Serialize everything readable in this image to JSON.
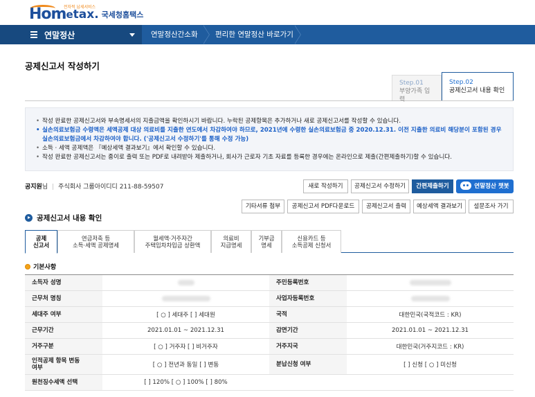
{
  "header": {
    "logo_main": "Hom",
    "logo_e": "e",
    "logo_tax": "tax.",
    "logo_tagline": "전자적 납세서비스",
    "logo_korean": "국세청홈택스"
  },
  "nav": {
    "main_label": "연말정산",
    "items": [
      "연말정산간소화",
      "편리한 연말정산 바로가기"
    ]
  },
  "page": {
    "title": "공제신고서 작성하기",
    "steps": [
      {
        "no": "Step.01",
        "label": "부양가족 입력"
      },
      {
        "no": "Step.02",
        "label": "공제신고서 내용 확인"
      }
    ]
  },
  "info": {
    "lines": [
      "작성 완료한 공제신고서와 부속명세서의 지출금액을 확인하시기 바랍니다. 누락된 공제항목은 추가하거나 새로 공제신고서를 작성할 수 있습니다.",
      "실손의료보험금 수령액은 세액공제 대상 의료비를 지출한 연도에서 차감하여야 하므로, 2021년에 수령한 실손의료보험금 중 2020.12.31. 이전 지출한 의료비 해당분이 포함된 경우 실손의료보험금에서 차감하여야 합니다. ('공제신고서 수정하기'를 통해 수정 가능)",
      "소득 · 세액 공제액은 『예상세액 결과보기』에서 확인할 수 있습니다.",
      "작성 완료한 공제신고서는 종이로 출력 또는 PDF로 내려받아 제출하거나, 회사가 근로자 기초 자료를 등록한 경우에는 온라인으로 제출(간편제출하기)할 수 있습니다."
    ]
  },
  "company": {
    "label": "공지원",
    "suffix": "님",
    "name": "주식회사 그룹아이디디 211-88-59507"
  },
  "buttons": {
    "new": "새로 작성하기",
    "edit": "공제신고서 수정하기",
    "submit": "간편제출하기",
    "chatbot": "연말정산 챗봇",
    "attach": "기타서류 첨부",
    "pdf": "공제신고서 PDF다운로드",
    "print": "공제신고서 출력",
    "estimate": "예상세액 결과보기",
    "survey": "설문조사 가기"
  },
  "section": {
    "title": "공제신고서 내용 확인",
    "subtitle": "기본사항"
  },
  "tabs": [
    {
      "line1": "공제",
      "line2": "신고서"
    },
    {
      "line1": "연금저축 등",
      "line2": "소득·세액 공제명세"
    },
    {
      "line1": "월세액·거주자간",
      "line2": "주택임차차입금 상환액"
    },
    {
      "line1": "의료비",
      "line2": "지급명세"
    },
    {
      "line1": "기부금",
      "line2": "명세"
    },
    {
      "line1": "신용카드 등",
      "line2": "소득공제 신청서"
    }
  ],
  "table": {
    "rows": [
      {
        "l1": "소득자 성명",
        "v1": "",
        "l2": "주민등록번호",
        "v2": ""
      },
      {
        "l1": "근무처 명칭",
        "v1": "",
        "l2": "사업자등록번호",
        "v2": ""
      },
      {
        "l1": "세대주 여부",
        "v1": "[ ○ ] 세대주  [   ] 세대원",
        "l2": "국적",
        "v2": "대한민국(국적코드 : KR)"
      },
      {
        "l1": "근무기간",
        "v1": "2021.01.01 ~ 2021.12.31",
        "l2": "감면기간",
        "v2": "2021.01.01 ~ 2021.12.31"
      },
      {
        "l1": "거주구분",
        "v1": "[ ○ ] 거주자  [   ] 비거주자",
        "l2": "거주지국",
        "v2": "대한민국(거주지코드 : KR)"
      },
      {
        "l1": "인적공제 항목 변동여부",
        "v1": "[ ○ ] 전년과 동일  [   ] 변동",
        "l2": "분납신청 여부",
        "v2": "[   ] 신청 [ ○ ] 미신청"
      },
      {
        "l1": "원천징수세액 선택",
        "v1": "[   ] 120%  [ ○ ] 100%  [   ] 80%",
        "l2": "",
        "v2": ""
      }
    ]
  }
}
